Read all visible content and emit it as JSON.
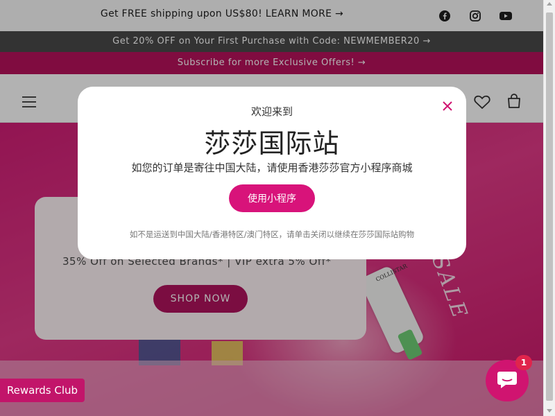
{
  "announcements": {
    "shipping": "Get FREE shipping upon US$80! LEARN MORE →",
    "discount": "Get 20% OFF on Your First Purchase with Code: NEWMEMBER20 →",
    "subscribe": "Subscribe for more Exclusive Offers! →"
  },
  "social_icons": [
    "facebook-icon",
    "instagram-icon",
    "youtube-icon"
  ],
  "header_icons": [
    "menu-icon",
    "heart-icon",
    "cart-icon"
  ],
  "hero": {
    "subtitle": "35% Off on Selected Brands* | VIP extra 5% Off*",
    "shop_button": "SHOP NOW",
    "product_label": "COLLISTAR",
    "sale_text": "SALE"
  },
  "modal": {
    "welcome": "欢迎来到",
    "title": "莎莎国际站",
    "description": "如您的订单是寄往中国大陆，请使用香港莎莎官方小程序商城",
    "button": "使用小程序",
    "note": "如不是运送到中国大陆/香港特区/澳门特区，请单击关闭以继续在莎莎国际站购物",
    "close_icon": "close-icon"
  },
  "rewards": {
    "label": "Rewards Club"
  },
  "chat": {
    "badge": "1",
    "icon": "chat-icon"
  },
  "colors": {
    "brand_pink": "#d8137a",
    "hero_pink": "#d21e76",
    "dark_bar": "#4a4a4a",
    "subscribe_bar": "#b8125c"
  }
}
